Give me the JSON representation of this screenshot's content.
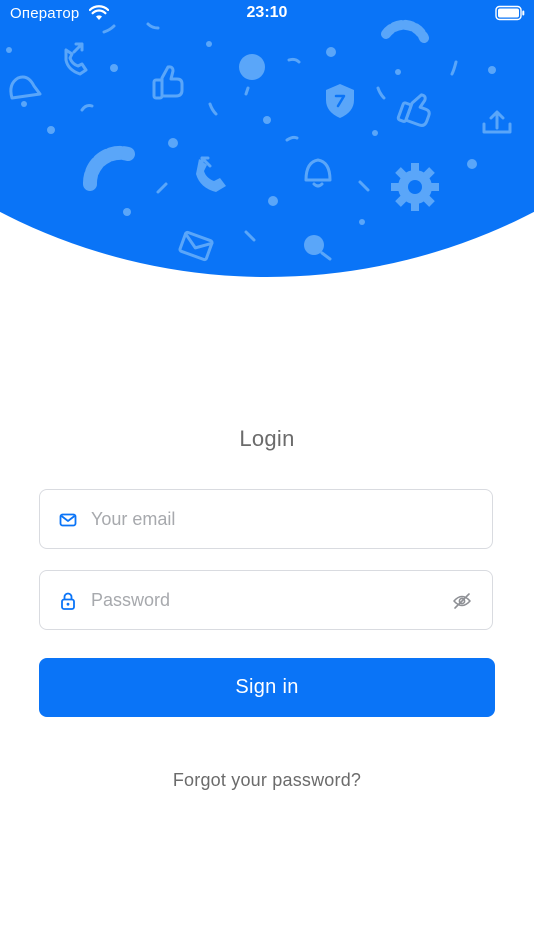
{
  "status_bar": {
    "carrier": "Оператор",
    "time": "23:10"
  },
  "login": {
    "title": "Login",
    "email_placeholder": "Your email",
    "email_value": "",
    "password_placeholder": "Password",
    "password_value": "",
    "sign_in_label": "Sign in",
    "forgot_label": "Forgot your password?"
  },
  "colors": {
    "primary": "#0a74f7",
    "pattern": "#5aa6f9",
    "muted_text": "#6b6b6b",
    "placeholder": "#a7a9ad",
    "field_border": "#d9dbe0"
  },
  "icons": {
    "email_field": "envelope-icon",
    "password_field": "lock-icon",
    "password_toggle": "eye-off-icon",
    "status_wifi": "wifi-icon",
    "status_battery": "battery-icon"
  }
}
